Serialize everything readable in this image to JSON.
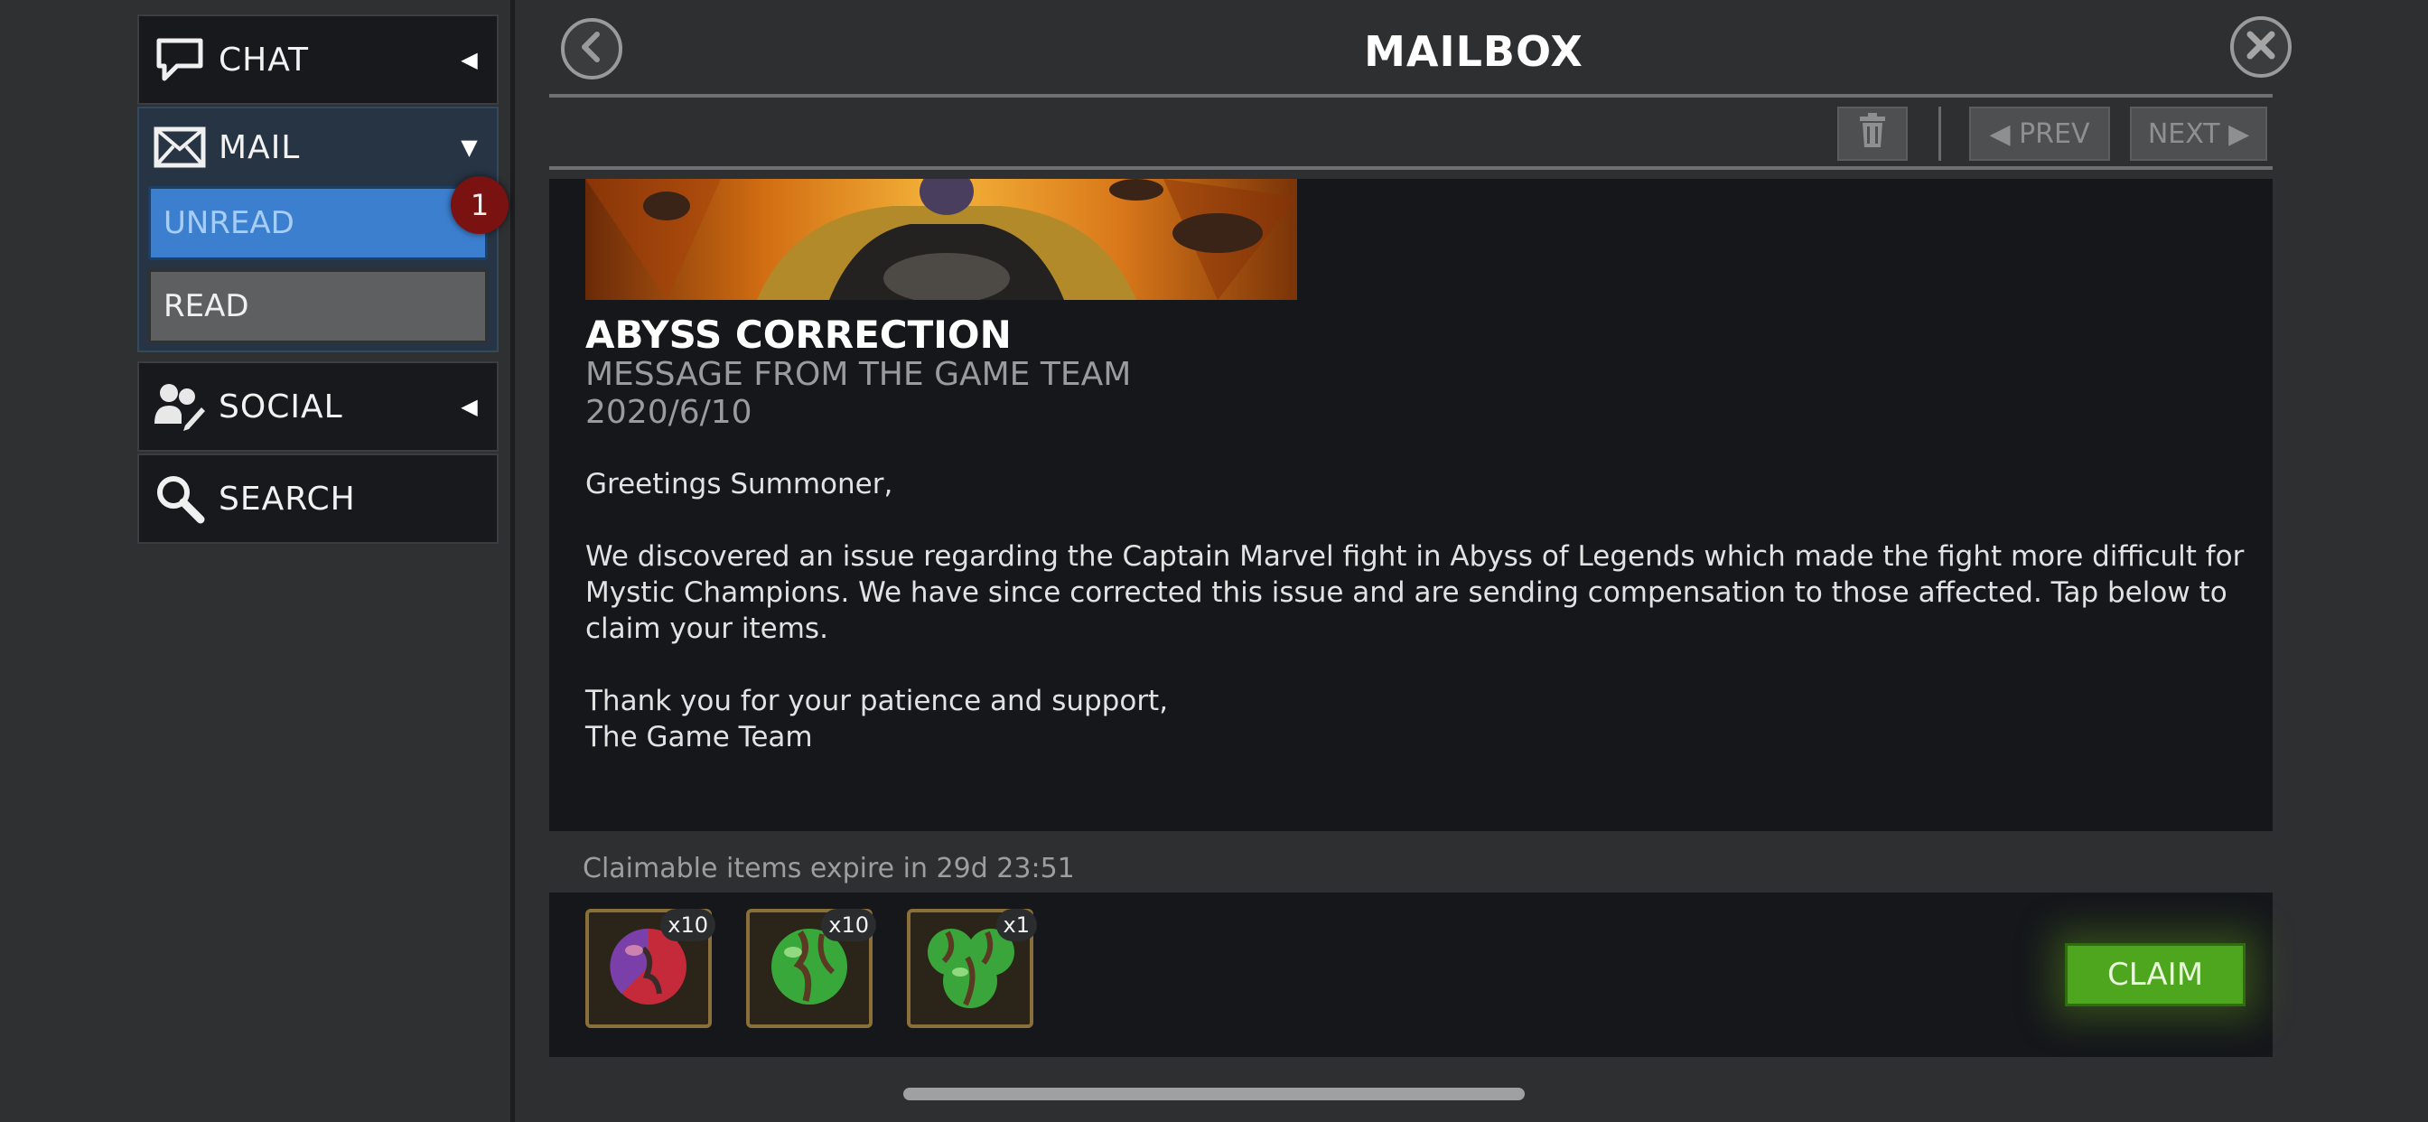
{
  "sidebar": {
    "chat": {
      "label": "CHAT",
      "icon": "chat-bubble-icon",
      "arrow": "◀"
    },
    "mail": {
      "label": "MAIL",
      "icon": "envelope-icon",
      "arrow": "▼",
      "unread_label": "UNREAD",
      "unread_count": "1",
      "read_label": "READ"
    },
    "social": {
      "label": "SOCIAL",
      "icon": "people-icon",
      "arrow": "◀"
    },
    "search": {
      "label": "SEARCH",
      "icon": "magnifier-icon"
    }
  },
  "header": {
    "title": "MAILBOX",
    "back_icon": "back-arrow-icon",
    "close_icon": "close-icon"
  },
  "toolbar": {
    "delete_icon": "trash-icon",
    "prev_label": "◀ PREV",
    "next_label": "NEXT ▶"
  },
  "message": {
    "title": "ABYSS CORRECTION",
    "sender": "MESSAGE FROM THE GAME TEAM",
    "date": "2020/6/10",
    "greeting": "Greetings Summoner,",
    "body": "We discovered an issue regarding the Captain Marvel fight in Abyss of Legends which made the fight more difficult for Mystic Champions. We have since corrected this issue and are sending compensation to those affected. Tap below to claim your items.",
    "closing_1": "Thank you for your patience and support,",
    "closing_2": "The Game Team"
  },
  "rewards": {
    "expire_text": "Claimable items expire in 29d 23:51",
    "items": [
      {
        "qty": "x10",
        "icon": "mystic-orb-icon",
        "color": "#c42a3a"
      },
      {
        "qty": "x10",
        "icon": "green-orb-icon",
        "color": "#39a83a"
      },
      {
        "qty": "x1",
        "icon": "green-orbs-icon",
        "color": "#3aa53a"
      }
    ],
    "claim_label": "CLAIM"
  },
  "colors": {
    "accent_blue": "#3d7fcf",
    "claim_green": "#4ea51e",
    "badge_red": "#7a1212"
  }
}
